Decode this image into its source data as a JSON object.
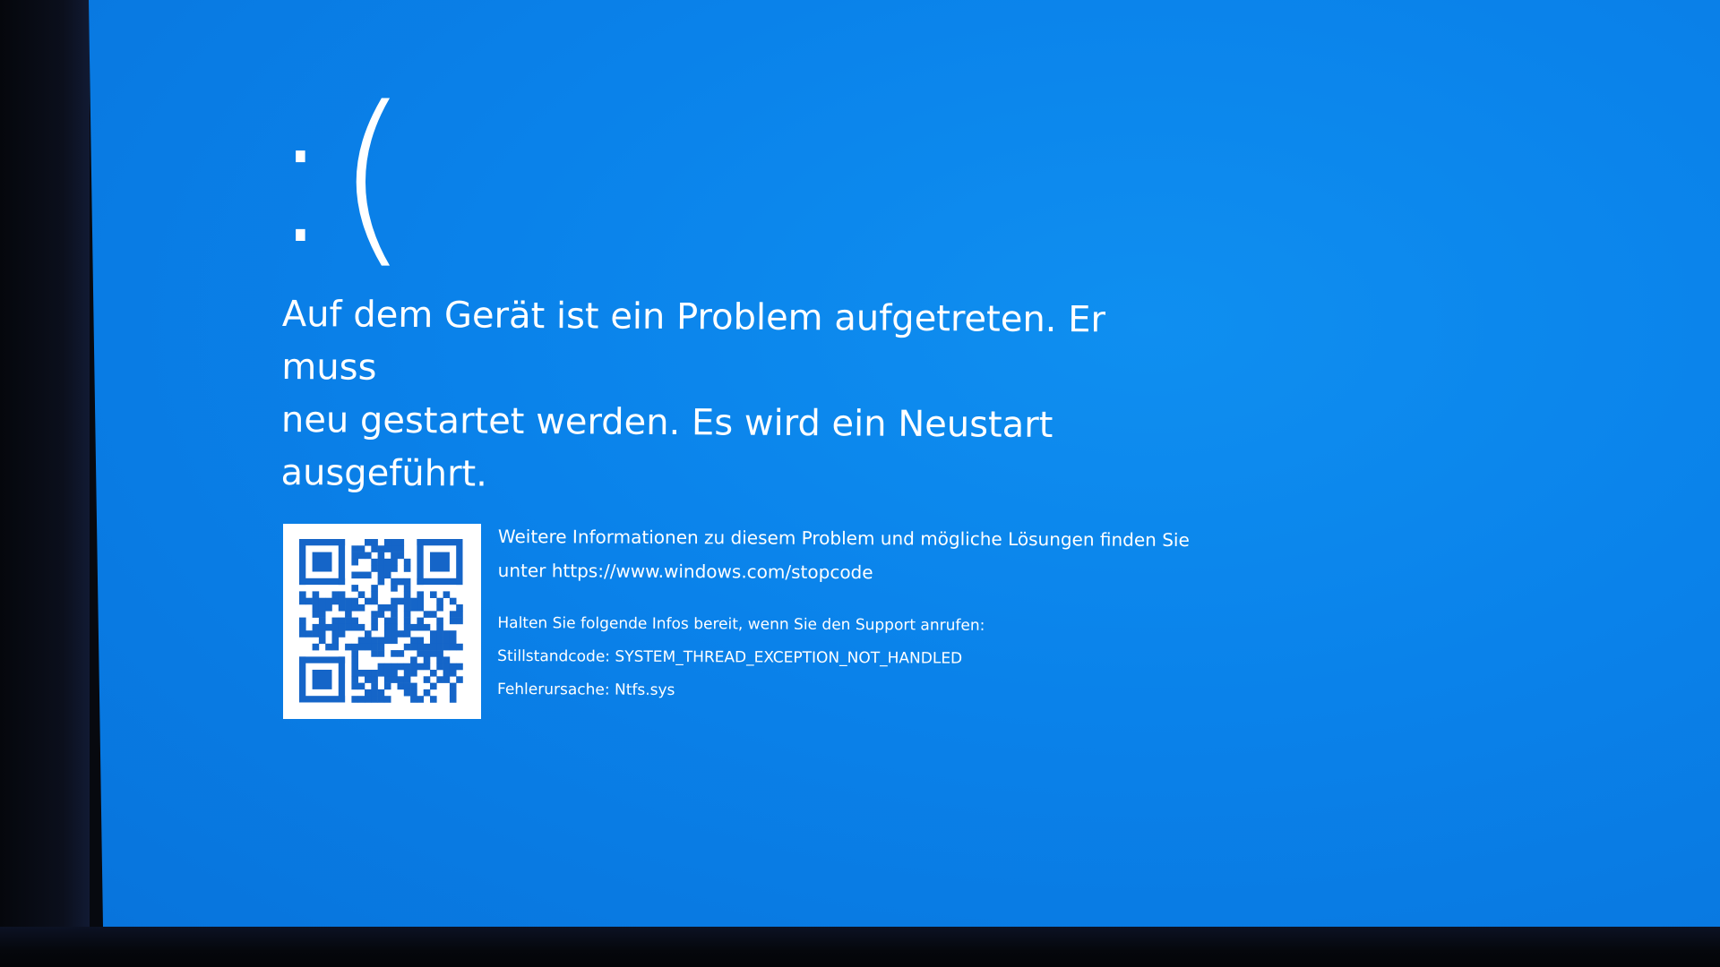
{
  "screen": {
    "background_color": "#0a82ea",
    "text_color": "#ffffff"
  },
  "sad_face": ":(",
  "message": {
    "line1": "Auf dem Gerät ist ein Problem aufgetreten. Er muss",
    "line2": "neu gestartet werden. Es wird ein Neustart ausgeführt."
  },
  "qr": {
    "icon": "qr-code-icon"
  },
  "info": {
    "more_line1": "Weitere Informationen zu diesem Problem und mögliche Lösungen finden Sie",
    "more_line2_prefix": "unter ",
    "url": "https://www.windows.com/stopcode",
    "support_hint": "Halten Sie folgende Infos bereit, wenn Sie den Support anrufen:",
    "stop_code_label": "Stillstandcode: ",
    "stop_code_value": "SYSTEM_THREAD_EXCEPTION_NOT_HANDLED",
    "cause_label": "Fehlerursache: ",
    "cause_value": "Ntfs.sys"
  }
}
